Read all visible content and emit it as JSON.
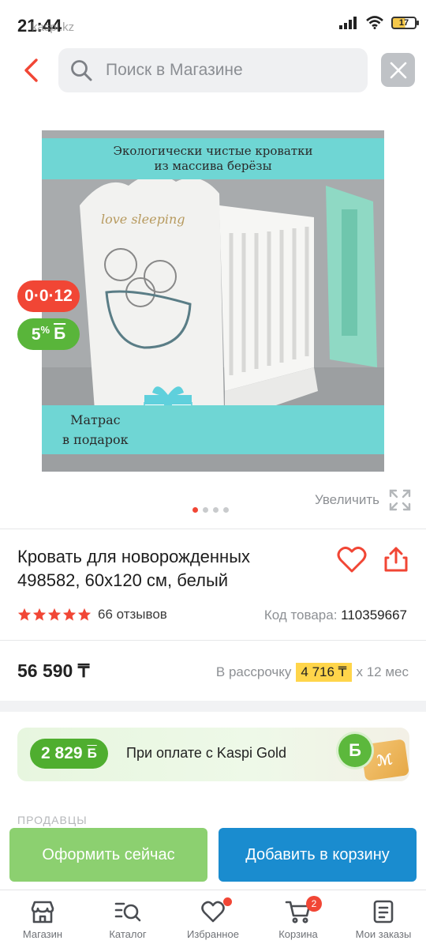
{
  "status_bar": {
    "time": "21:44",
    "watermark": "kaspi.kz",
    "battery": "17"
  },
  "search": {
    "placeholder": "Поиск в Магазине"
  },
  "product": {
    "image_banner_top_line1": "Экологически чистые кроватки",
    "image_banner_top_line2": "из массива берёзы",
    "image_banner_bottom_line1": "Матрас",
    "image_banner_bottom_line2": "в подарок",
    "image_engraving": "love sleeping",
    "timer_badge": "0·0·12",
    "bonus_badge_value": "5",
    "bonus_badge_unit": "%",
    "bonus_badge_symbol": "Б",
    "gallery_pages": 4,
    "gallery_current": 1,
    "zoom_label": "Увеличить",
    "title": "Кровать для новорожденных 498582, 60x120 см, белый",
    "rating": 5,
    "reviews": "66 отзывов",
    "sku_label": "Код товара:",
    "sku_value": "110359667",
    "price": "56 590 ₸",
    "installment_label": "В рассрочку",
    "installment_amount": "4 716 ₸",
    "installment_term": "х 12 мес"
  },
  "kaspi_gold": {
    "amount": "2 829",
    "amount_symbol": "Б",
    "text": "При оплате с Kaspi Gold",
    "coin_symbol": "Б"
  },
  "sellers_label": "ПРОДАВЦЫ",
  "actions": {
    "checkout": "Оформить сейчас",
    "add_to_cart": "Добавить в корзину"
  },
  "nav": {
    "shop": "Магазин",
    "catalog": "Каталог",
    "favorites": "Избранное",
    "cart": "Корзина",
    "cart_count": "2",
    "orders": "Мои заказы"
  },
  "colors": {
    "accent_red": "#f14635",
    "bonus_green": "#59b53a",
    "primary_blue": "#1a8ccf",
    "checkout_green": "#8cd070",
    "highlight_yellow": "#ffd54a"
  }
}
